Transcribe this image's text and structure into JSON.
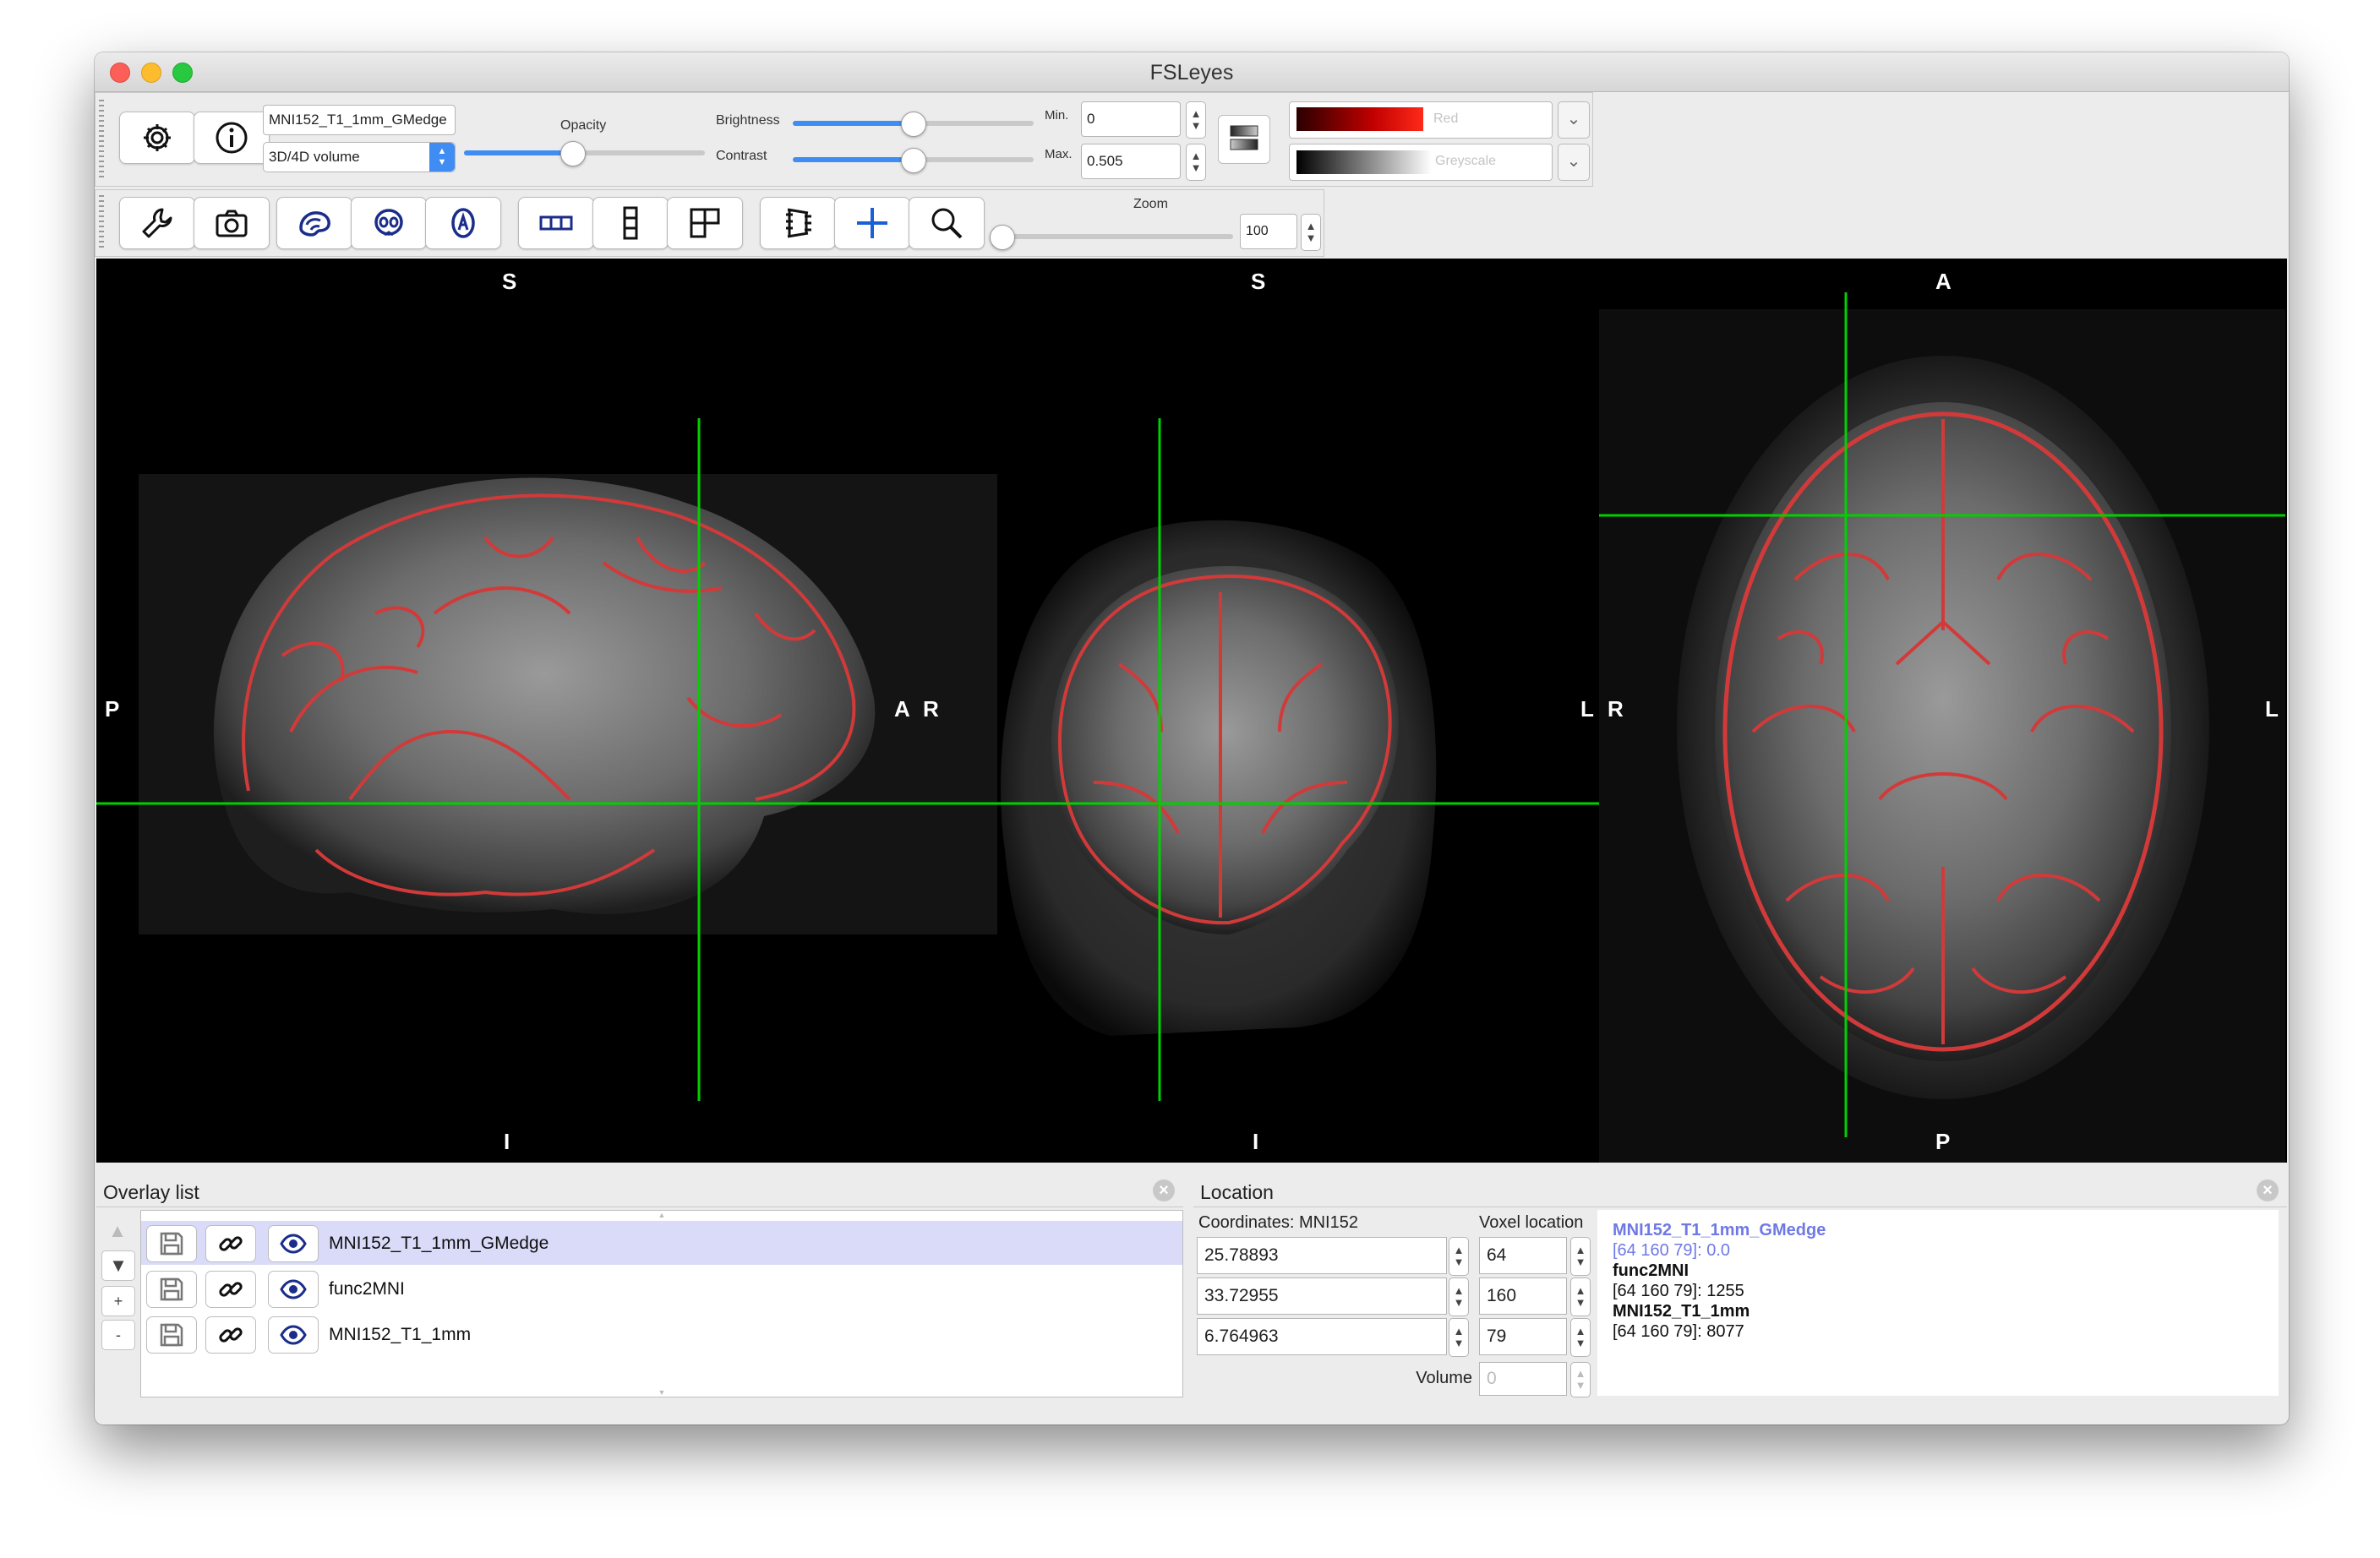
{
  "window": {
    "title": "FSLeyes"
  },
  "toolbar1": {
    "overlay_name": "MNI152_T1_1mm_GMedge",
    "overlay_type": "3D/4D volume",
    "opacity_label": "Opacity",
    "opacity_value": 0.45,
    "brightness_label": "Brightness",
    "brightness_value": 0.5,
    "contrast_label": "Contrast",
    "contrast_value": 0.5,
    "min_label": "Min.",
    "min_value": "0",
    "max_label": "Max.",
    "max_value": "0.505",
    "colormap1": "Red",
    "colormap2": "Greyscale"
  },
  "toolbar2": {
    "zoom_label": "Zoom",
    "zoom_value": "100"
  },
  "viewer": {
    "sagittal": {
      "top": "S",
      "bottom": "I",
      "left": "P",
      "right": "A"
    },
    "coronal": {
      "top": "S",
      "bottom": "I",
      "left": "R",
      "right": "L"
    },
    "axial": {
      "top": "A",
      "bottom": "P",
      "left": "R",
      "right": "L"
    }
  },
  "overlay_list": {
    "title": "Overlay list",
    "items": [
      {
        "name": "MNI152_T1_1mm_GMedge",
        "selected": true
      },
      {
        "name": "func2MNI",
        "selected": false
      },
      {
        "name": "MNI152_T1_1mm",
        "selected": false
      }
    ],
    "buttons": {
      "up": "▲",
      "down": "▼",
      "add": "+",
      "remove": "-"
    }
  },
  "location": {
    "title": "Location",
    "coord_label": "Coordinates: MNI152",
    "voxel_label": "Voxel location",
    "coords": [
      "25.78893",
      "33.72955",
      "6.764963"
    ],
    "voxels": [
      "64",
      "160",
      "79"
    ],
    "volume_label": "Volume",
    "volume_value": "0",
    "info": [
      {
        "name": "MNI152_T1_1mm_GMedge",
        "value": "[64 160 79]: 0.0",
        "highlight": true
      },
      {
        "name": "func2MNI",
        "value": "[64 160 79]: 1255",
        "highlight": false
      },
      {
        "name": "MNI152_T1_1mm",
        "value": "[64 160 79]: 8077",
        "highlight": false
      }
    ]
  },
  "colors": {
    "accent": "#3f8cf3",
    "crosshair": "#00d000",
    "edge": "#d23a3a",
    "selected_row": "#d9dbf8",
    "info_highlight": "#6f79e6"
  }
}
